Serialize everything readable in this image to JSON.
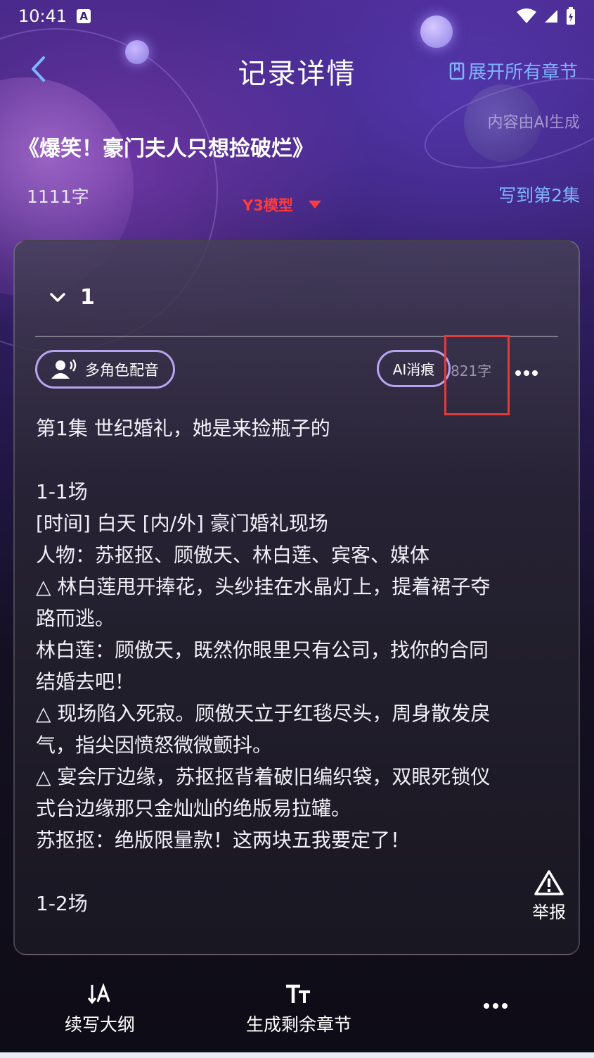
{
  "status": {
    "time": "10:41",
    "icons": [
      "notification-a-icon",
      "wifi-icon",
      "signal-icon",
      "battery-icon"
    ]
  },
  "header": {
    "title": "记录详情",
    "expand_all": "展开所有章节",
    "ai_note": "内容由AI生成"
  },
  "book": {
    "title": "《爆笑！豪门夫人只想捡破烂》",
    "word_count": "1111字",
    "model": "Y3模型",
    "write_to": "写到第2集"
  },
  "card": {
    "chapter_number": "1",
    "multi_role_label": "多角色配音",
    "ai_remove_label": "AI消痕",
    "chapter_word_count": "821字",
    "lines": [
      "第1集 世纪婚礼，她是来捡瓶子的",
      "",
      "1-1场",
      "[时间] 白天 [内/外] 豪门婚礼现场",
      "人物：苏抠抠、顾傲天、林白莲、宾客、媒体",
      "△ 林白莲甩开捧花，头纱挂在水晶灯上，提着裙子夺",
      "路而逃。",
      "林白莲：顾傲天，既然你眼里只有公司，找你的合同",
      "结婚去吧！",
      "△ 现场陷入死寂。顾傲天立于红毯尽头，周身散发戾",
      "气，指尖因愤怒微微颤抖。",
      "△ 宴会厅边缘，苏抠抠背着破旧编织袋，双眼死锁仪",
      "式台边缘那只金灿灿的绝版易拉罐。",
      "苏抠抠：绝版限量款！这两块五我要定了！",
      "",
      "1-2场"
    ],
    "report_label": "举报"
  },
  "bottom": {
    "continue_outline": "续写大纲",
    "generate_remaining": "生成剩余章节"
  },
  "colors": {
    "accent_blue": "#7fb4ff",
    "model_red": "#ff3b3b",
    "highlight_red": "#e53a3a",
    "button_border": "#b7a4f0"
  }
}
